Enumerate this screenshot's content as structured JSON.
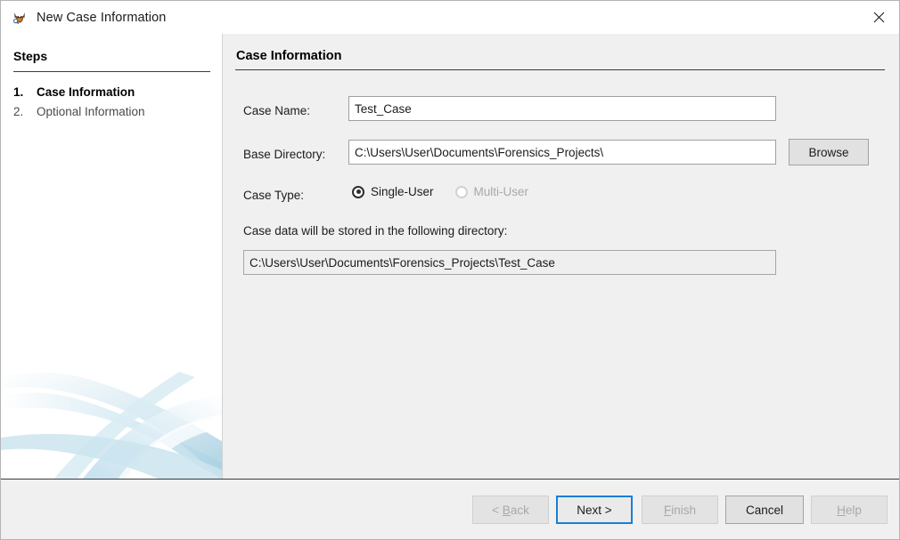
{
  "window": {
    "title": "New Case Information",
    "icon": "autopsy-logo-icon",
    "close_label": "✕"
  },
  "steps": {
    "heading": "Steps",
    "items": [
      {
        "number": "1.",
        "label": "Case Information",
        "active": true
      },
      {
        "number": "2.",
        "label": "Optional Information",
        "active": false
      }
    ]
  },
  "content": {
    "heading": "Case Information",
    "fields": {
      "case_name_label": "Case Name:",
      "case_name_value": "Test_Case",
      "base_directory_label": "Base Directory:",
      "base_directory_value": "C:\\Users\\User\\Documents\\Forensics_Projects\\",
      "browse_label": "Browse",
      "case_type_label": "Case Type:",
      "case_type_options": [
        {
          "label": "Single-User",
          "selected": true,
          "disabled": false
        },
        {
          "label": "Multi-User",
          "selected": false,
          "disabled": true
        }
      ],
      "storage_hint": "Case data will be stored in the following directory:",
      "storage_path": "C:\\Users\\User\\Documents\\Forensics_Projects\\Test_Case"
    }
  },
  "footer": {
    "buttons": [
      {
        "label": "< Back",
        "mnemonic": "B",
        "state": "disabled"
      },
      {
        "label": "Next >",
        "mnemonic": "",
        "state": "default"
      },
      {
        "label": "Finish",
        "mnemonic": "F",
        "state": "disabled"
      },
      {
        "label": "Cancel",
        "mnemonic": "",
        "state": "enabled"
      },
      {
        "label": "Help",
        "mnemonic": "H",
        "state": "disabled"
      }
    ]
  },
  "colors": {
    "accent_focus": "#1a7fd4",
    "panel_bg": "#f0f0f0",
    "steps_bg": "#ffffff",
    "swoosh": "#bfdcea"
  }
}
